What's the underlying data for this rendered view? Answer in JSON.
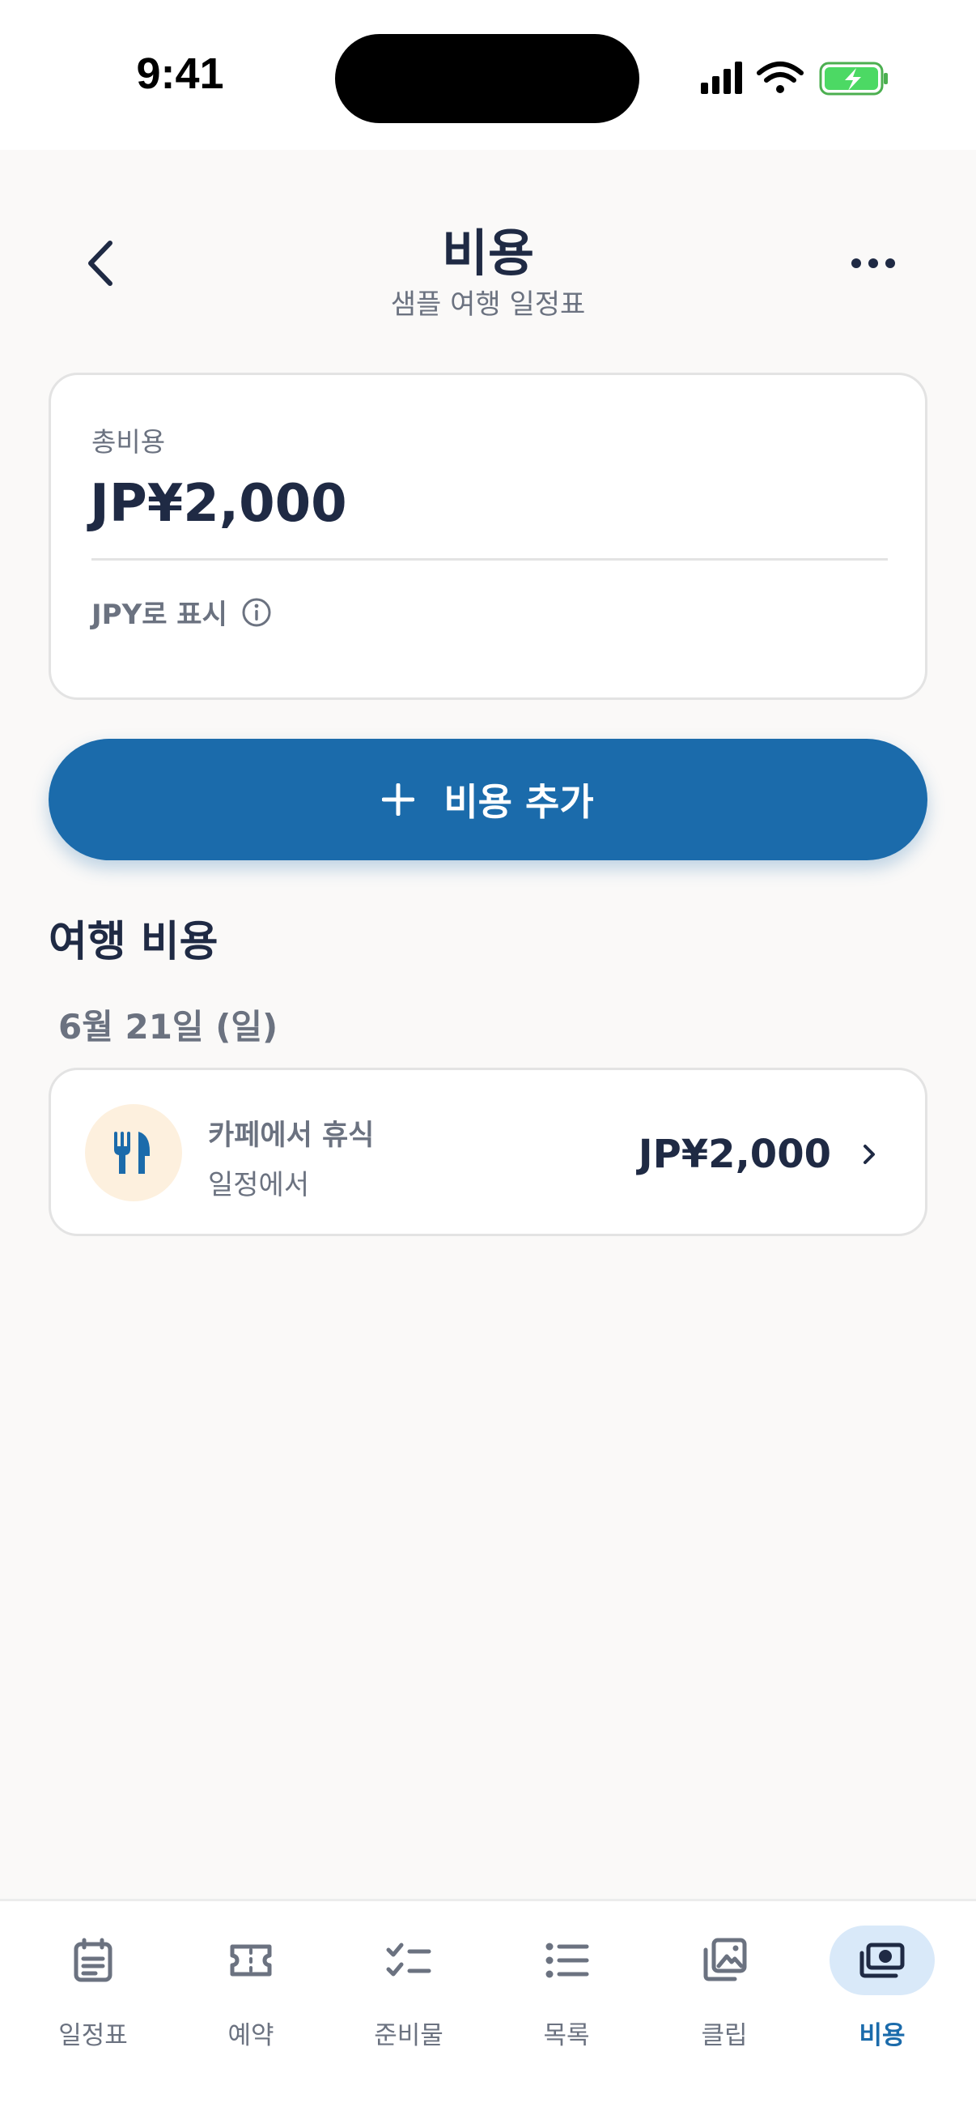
{
  "status_bar": {
    "time": "9:41"
  },
  "header": {
    "title": "비용",
    "subtitle": "샘플 여행 일정표"
  },
  "total_card": {
    "label": "총비용",
    "amount": "JP¥2,000",
    "currency_note": "JPY로 표시"
  },
  "add_button": {
    "label": "비용 추가"
  },
  "section": {
    "title": "여행 비용"
  },
  "groups": [
    {
      "date": "6월 21일 (일)",
      "items": [
        {
          "title": "카페에서 휴식",
          "subtitle": "일정에서",
          "amount": "JP¥2,000",
          "icon": "fork-knife-icon"
        }
      ]
    }
  ],
  "tabs": [
    {
      "label": "일정표",
      "icon": "itinerary-icon",
      "active": false
    },
    {
      "label": "예약",
      "icon": "ticket-icon",
      "active": false
    },
    {
      "label": "준비물",
      "icon": "checklist-icon",
      "active": false
    },
    {
      "label": "목록",
      "icon": "list-icon",
      "active": false
    },
    {
      "label": "클립",
      "icon": "gallery-icon",
      "active": false
    },
    {
      "label": "비용",
      "icon": "money-icon",
      "active": true
    }
  ],
  "colors": {
    "accent": "#1b6bab",
    "text_primary": "#1f2a44",
    "text_secondary": "#6b7280",
    "icon_bg": "#fdf0de",
    "active_tab_bg": "#d9e9f9"
  }
}
